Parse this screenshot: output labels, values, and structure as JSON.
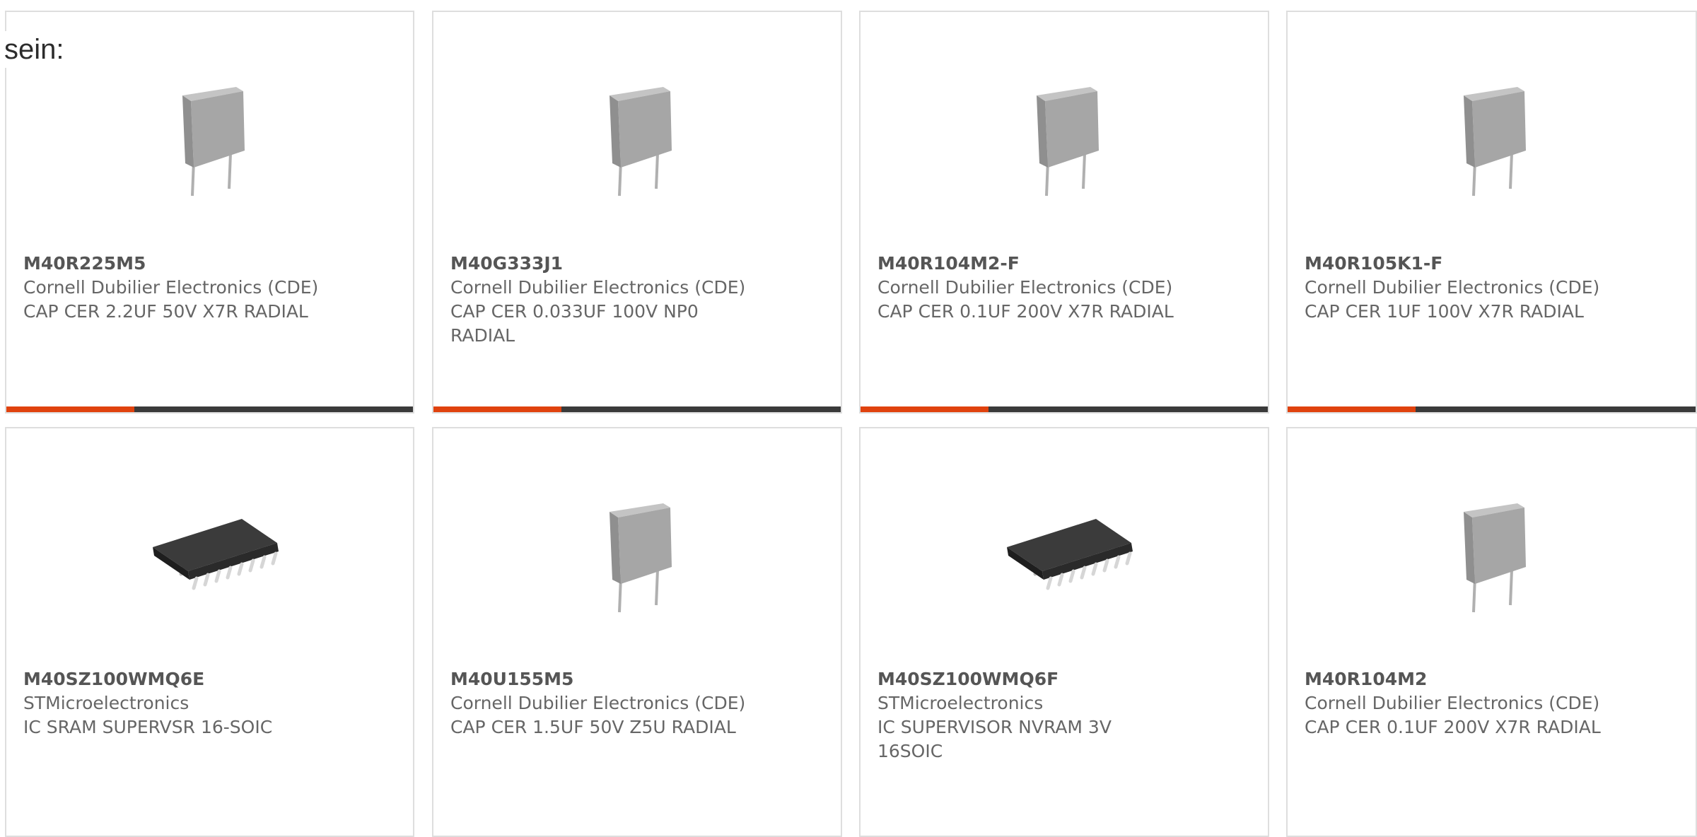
{
  "intro_text": "sein:",
  "colors": {
    "accent": "#e0420e",
    "bar": "#3a3a3a",
    "border": "#dedede",
    "part_number": "#555555",
    "body_text": "#666666"
  },
  "products": [
    {
      "part_number": "M40R225M5",
      "manufacturer": "Cornell Dubilier Electronics (CDE)",
      "description": "CAP CER 2.2UF 50V X7R RADIAL",
      "image_icon": "radial-capacitor-icon"
    },
    {
      "part_number": "M40G333J1",
      "manufacturer": "Cornell Dubilier Electronics (CDE)",
      "description": "CAP CER 0.033UF 100V NP0 RADIAL",
      "image_icon": "radial-capacitor-icon"
    },
    {
      "part_number": "M40R104M2-F",
      "manufacturer": "Cornell Dubilier Electronics (CDE)",
      "description": "CAP CER 0.1UF 200V X7R RADIAL",
      "image_icon": "radial-capacitor-icon"
    },
    {
      "part_number": "M40R105K1-F",
      "manufacturer": "Cornell Dubilier Electronics (CDE)",
      "description": "CAP CER 1UF 100V X7R RADIAL",
      "image_icon": "radial-capacitor-icon"
    },
    {
      "part_number": "M40SZ100WMQ6E",
      "manufacturer": "STMicroelectronics",
      "description": "IC SRAM SUPERVSR 16-SOIC",
      "image_icon": "soic-chip-icon"
    },
    {
      "part_number": "M40U155M5",
      "manufacturer": "Cornell Dubilier Electronics (CDE)",
      "description": "CAP CER 1.5UF 50V Z5U RADIAL",
      "image_icon": "radial-capacitor-icon"
    },
    {
      "part_number": "M40SZ100WMQ6F",
      "manufacturer": "STMicroelectronics",
      "description": "IC SUPERVISOR NVRAM 3V 16SOIC",
      "image_icon": "soic-chip-icon"
    },
    {
      "part_number": "M40R104M2",
      "manufacturer": "Cornell Dubilier Electronics (CDE)",
      "description": "CAP CER 0.1UF 200V X7R RADIAL",
      "image_icon": "radial-capacitor-icon"
    }
  ]
}
